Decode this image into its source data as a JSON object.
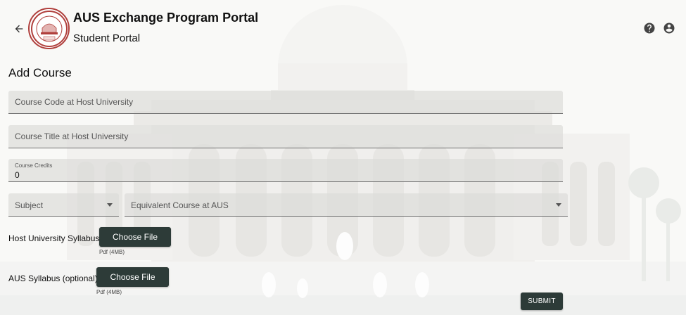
{
  "header": {
    "title": "AUS Exchange Program Portal",
    "subtitle": "Student Portal",
    "logo_text": "American University of Sharjah 1997",
    "icons": [
      "back-arrow-icon",
      "help-icon",
      "account-circle-icon"
    ]
  },
  "form": {
    "heading": "Add Course",
    "course_code": {
      "placeholder": "Course Code at Host University",
      "value": ""
    },
    "course_title": {
      "placeholder": "Course Title at Host University",
      "value": ""
    },
    "course_credits": {
      "label": "Course Credits",
      "value": "0"
    },
    "subject_select": {
      "label": "Subject"
    },
    "equivalent_select": {
      "label": "Equivalent Course at AUS"
    },
    "host_syllabus": {
      "label": "Host University Syllabus",
      "button": "Choose File",
      "hint": "Pdf (4MB)"
    },
    "aus_syllabus": {
      "label": "AUS Syllabus (optional)",
      "button": "Choose File",
      "hint": "Pdf (4MB)"
    },
    "submit_label": "SUBMIT"
  },
  "colors": {
    "button_bg": "#2d3b38",
    "logo_red": "#b0403d",
    "field_bg": "#dcdcda"
  }
}
